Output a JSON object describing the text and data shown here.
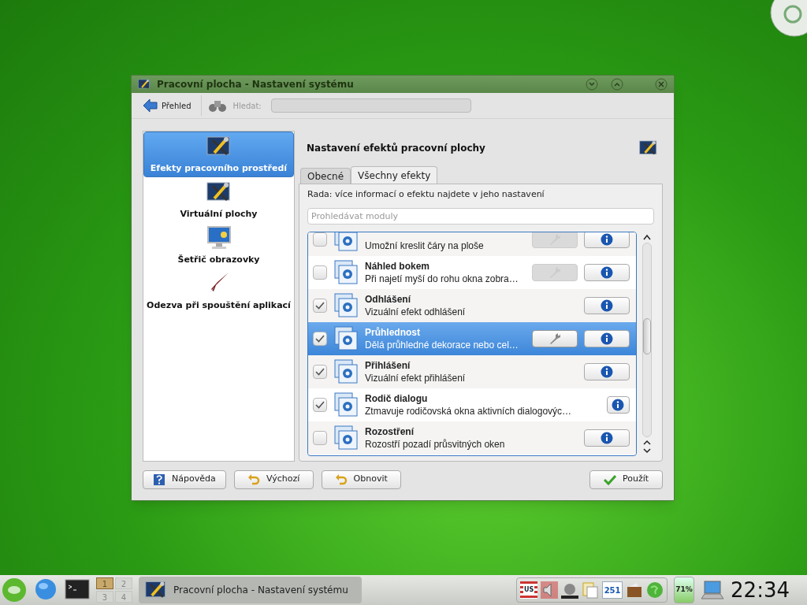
{
  "window": {
    "title": "Pracovní plocha - Nastavení systému"
  },
  "toolbar": {
    "overview": "Přehled",
    "search_label": "Hledat:"
  },
  "sidebar": {
    "items": [
      {
        "label": "Efekty pracovního prostředí",
        "kind": "tools",
        "selected": true
      },
      {
        "label": "Virtuální plochy",
        "kind": "tools",
        "selected": false
      },
      {
        "label": "Šetřič obrazovky",
        "kind": "monitor",
        "selected": false
      },
      {
        "label": "Odezva při spouštění aplikací",
        "kind": "rocket",
        "selected": false
      }
    ]
  },
  "header": {
    "title": "Nastavení efektů pracovní plochy"
  },
  "tabs": [
    {
      "label": "Obecné",
      "selected": false
    },
    {
      "label": "Všechny efekty",
      "selected": true
    }
  ],
  "hint": "Rada: více informací o efektu najdete v jeho nastavení",
  "filter": {
    "placeholder": "Prohledávat moduly"
  },
  "effects": [
    {
      "description": "Umožní kreslit čáry na ploše",
      "checked": false,
      "selected": false,
      "settings": {
        "disabled": true
      }
    },
    {
      "title": "Náhled bokem",
      "description": "Při najetí myší do rohu okna zobra…",
      "checked": false,
      "selected": false,
      "settings": {
        "disabled": true
      }
    },
    {
      "title": "Odhlášení",
      "description": "Vizuální efekt odhlášení",
      "checked": true,
      "selected": false
    },
    {
      "title": "Průhlednost",
      "description": "Dělá průhledné dekorace nebo cel…",
      "checked": true,
      "selected": true,
      "settings": {
        "disabled": false
      }
    },
    {
      "title": "Přihlášení",
      "description": "Vizuální efekt přihlášení",
      "checked": true,
      "selected": false
    },
    {
      "title": "Rodič dialogu",
      "description": "Ztmavuje rodičovská okna aktivních dialogovýc…",
      "checked": true,
      "selected": false
    },
    {
      "title": "Rozostření",
      "description": "Rozostří pozadí průsvitných oken",
      "checked": false,
      "selected": false
    }
  ],
  "buttons": [
    {
      "label": "Nápověda",
      "kind": "help"
    },
    {
      "label": "Výchozí",
      "kind": "defaults"
    },
    {
      "label": "Obnovit",
      "kind": "reset"
    },
    {
      "label": "Použít",
      "kind": "apply"
    }
  ],
  "taskbar": {
    "pager": [
      {
        "label": "1",
        "selected": true
      },
      {
        "label": "2",
        "selected": false
      },
      {
        "label": "3",
        "selected": false
      },
      {
        "label": "4",
        "selected": false
      }
    ],
    "task": "Pracovní plocha - Nastavení systému",
    "keyboard": "US",
    "update_count": "251",
    "battery": "71%",
    "clock": "22:34"
  }
}
